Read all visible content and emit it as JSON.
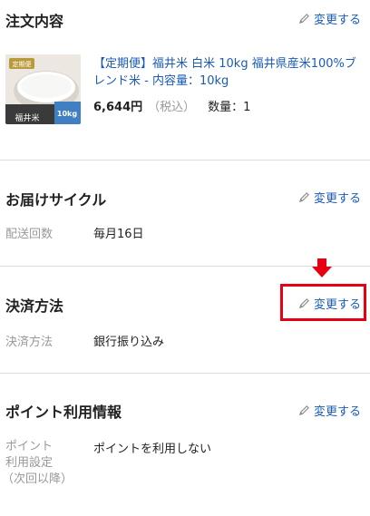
{
  "order": {
    "title": "注文内容",
    "change_label": "変更する",
    "product": {
      "name": "【定期便】福井米 白米 10kg 福井県産米100%ブレンド米 - 内容量：10kg",
      "price": "6,644円",
      "tax_note": "（税込）",
      "quantity": "数量：1",
      "image_badge": "定期便",
      "image_bag_text": "福井米",
      "image_weight": "10kg"
    }
  },
  "cycle": {
    "title": "お届けサイクル",
    "change_label": "変更する",
    "label": "配送回数",
    "value": "毎月16日"
  },
  "payment": {
    "title": "決済方法",
    "change_label": "変更する",
    "label": "決済方法",
    "value": "銀行振り込み"
  },
  "points": {
    "title": "ポイント利用情報",
    "change_label": "変更する",
    "label_line1": "ポイント",
    "label_line2": "利用設定",
    "label_line3": "（次回以降）",
    "value": "ポイントを利用しない"
  },
  "colors": {
    "link": "#1a5ab8",
    "highlight": "#e60012",
    "divider": "#dcdcdc"
  }
}
